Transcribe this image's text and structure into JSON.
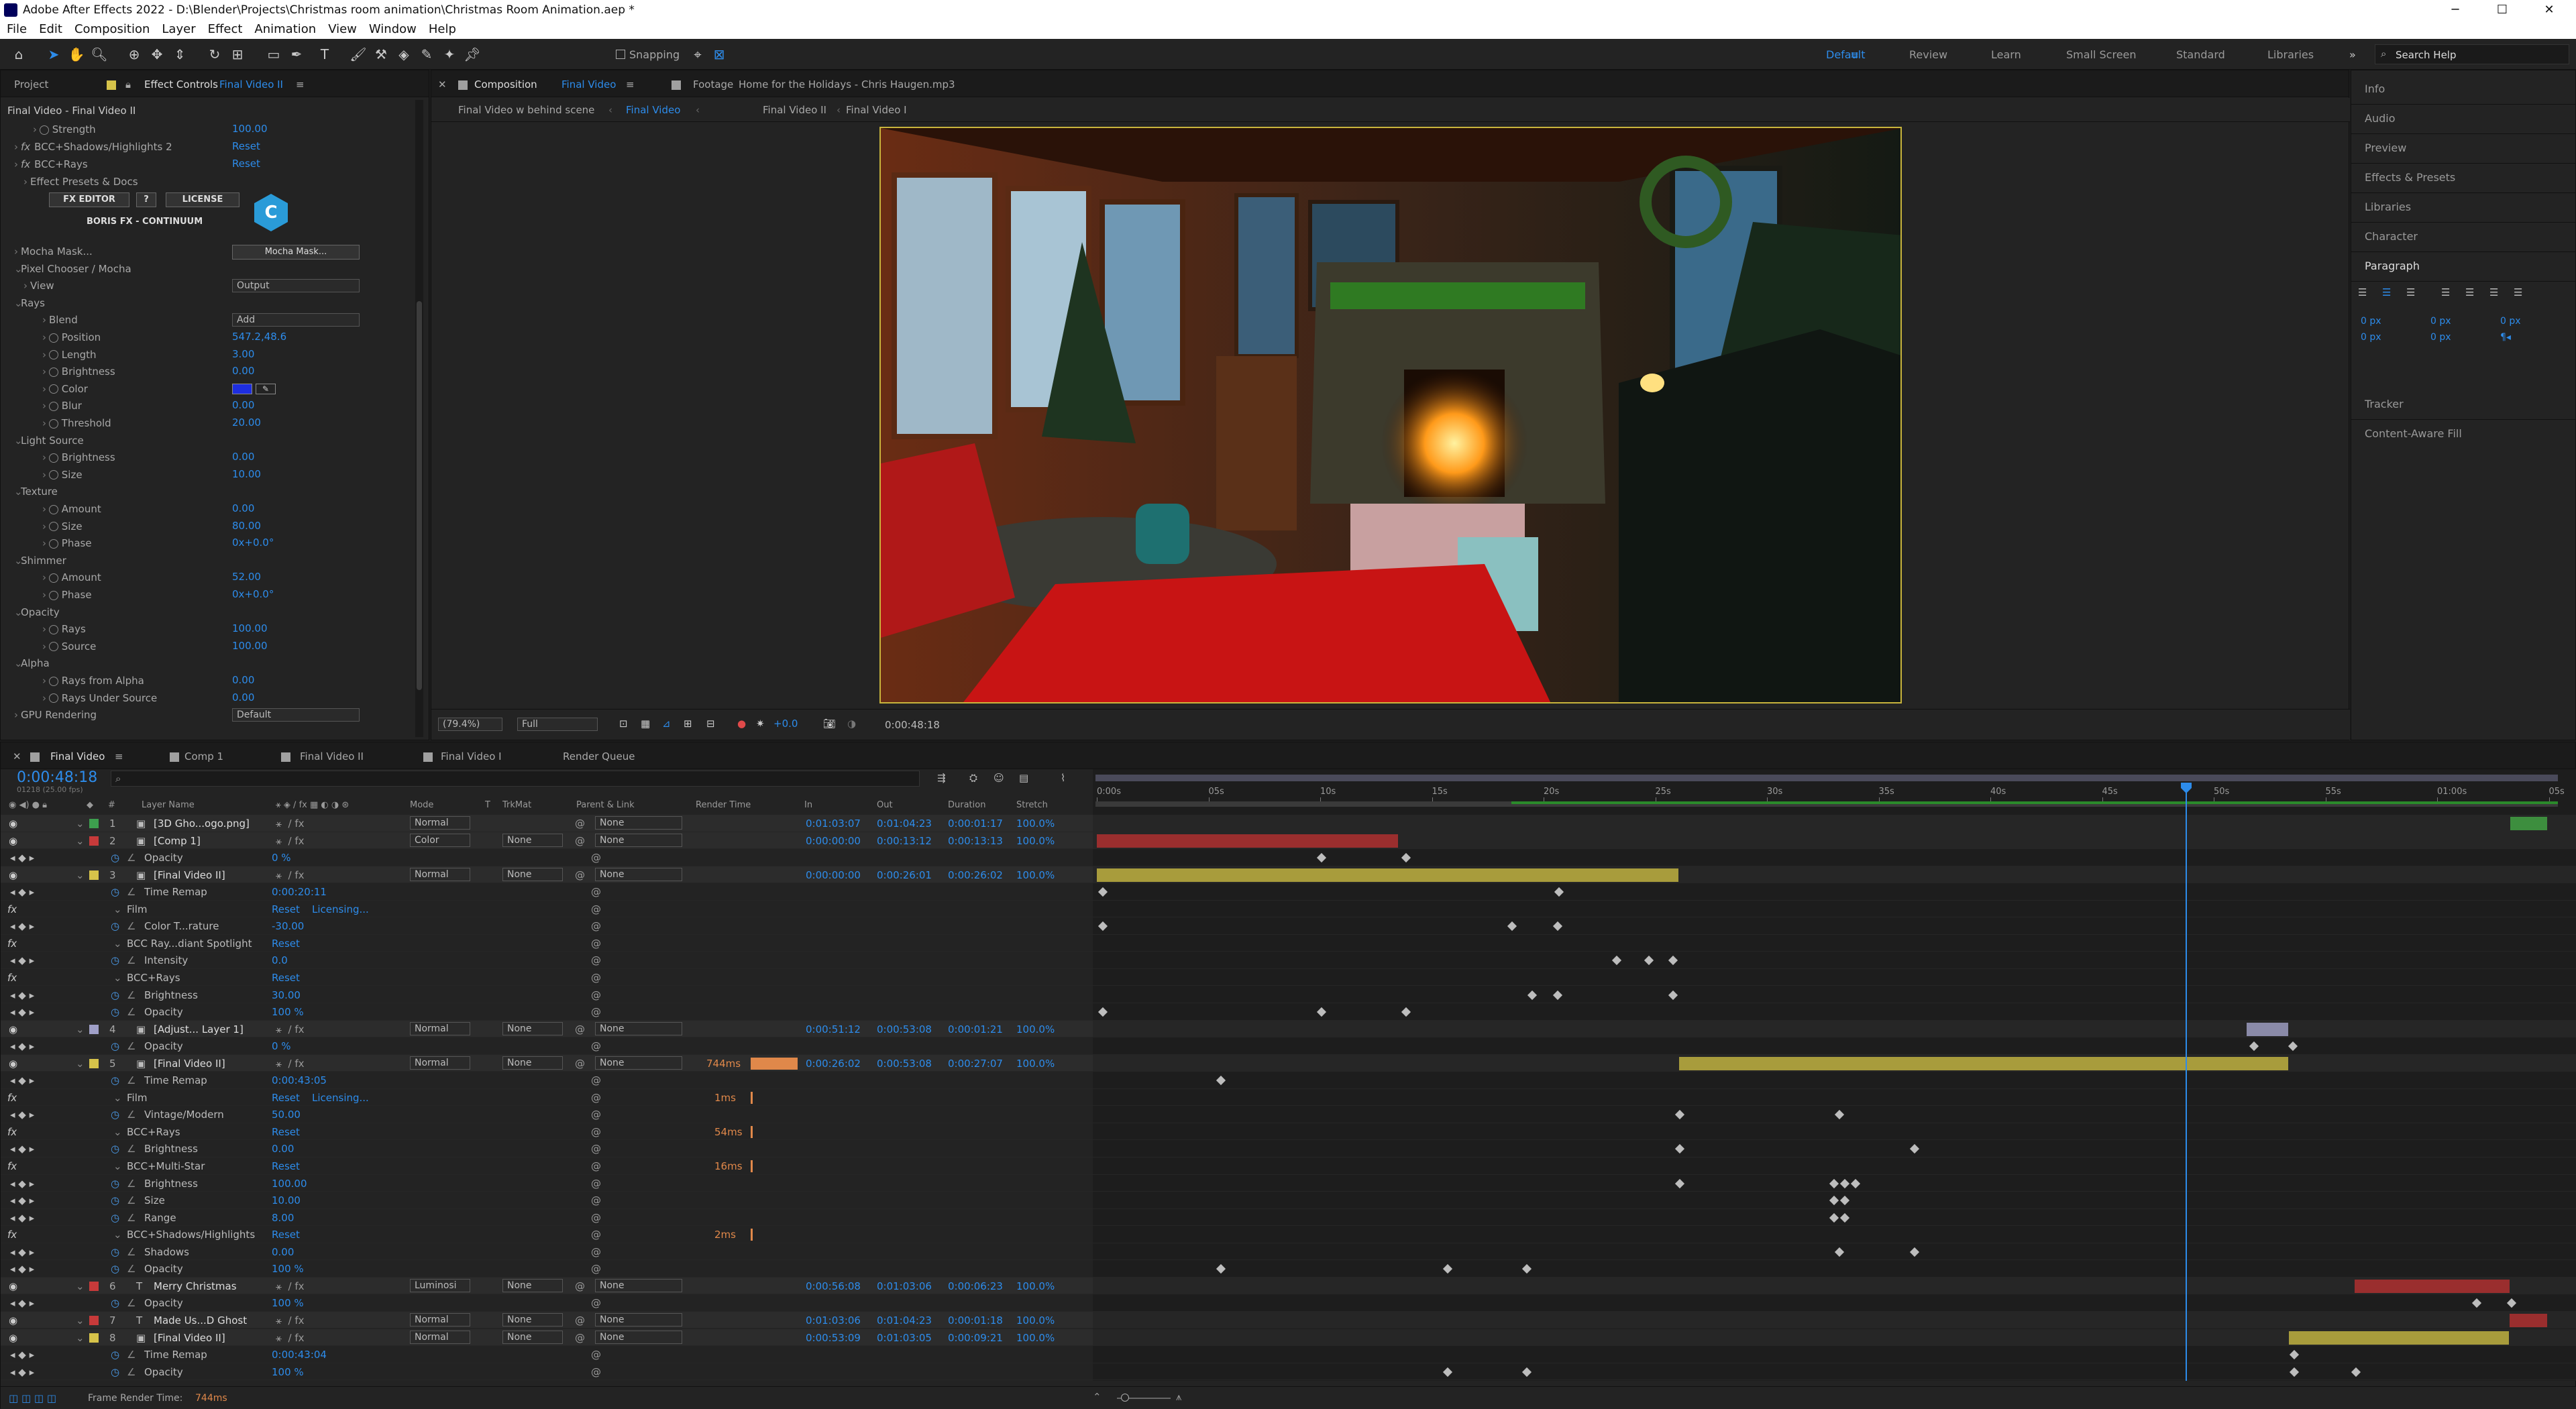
{
  "window": {
    "title": "Adobe After Effects 2022 - D:\\Blender\\Projects\\Christmas room animation\\Christmas Room Animation.aep *",
    "min": "─",
    "max": "☐",
    "close": "✕"
  },
  "menu": [
    "File",
    "Edit",
    "Composition",
    "Layer",
    "Effect",
    "Animation",
    "View",
    "Window",
    "Help"
  ],
  "toolbar": {
    "snapping": "Snapping",
    "workspaces": [
      "Default",
      "Review",
      "Learn",
      "Small Screen",
      "Standard",
      "Libraries"
    ],
    "search_placeholder": "Search Help"
  },
  "effect_controls": {
    "project_tab": "Project",
    "tab": "Effect Controls",
    "tab_layer": "Final Video II",
    "header": "Final Video - Final Video II",
    "rows": [
      {
        "label": "Strength",
        "value": "100.00",
        "indent": 3,
        "sw": true
      },
      {
        "label": "BCC+Shadows/Highlights 2",
        "value": "Reset",
        "indent": 1,
        "fx": true
      },
      {
        "label": "BCC+Rays",
        "value": "Reset",
        "indent": 1,
        "fx": true
      },
      {
        "label": "Effect Presets & Docs",
        "value": "",
        "indent": 2
      }
    ],
    "fx_editor": "FX EDITOR",
    "help_btn": "?",
    "license": "LICENSE",
    "brand": "BORIS FX - CONTINUUM",
    "brand_logo": "C",
    "rows2": [
      {
        "label": "Mocha Mask...",
        "btn": "Mocha Mask..."
      },
      {
        "label": "Pixel Chooser / Mocha"
      },
      {
        "label": "View",
        "dd": "Output"
      },
      {
        "label": "Rays"
      },
      {
        "label": "Blend",
        "dd": "Add"
      },
      {
        "label": "Position",
        "value": "547.2,48.6"
      },
      {
        "label": "Length",
        "value": "3.00"
      },
      {
        "label": "Brightness",
        "value": "0.00"
      },
      {
        "label": "Color",
        "value": ""
      },
      {
        "label": "Blur",
        "value": "0.00"
      },
      {
        "label": "Threshold",
        "value": "20.00"
      },
      {
        "label": "Light Source"
      },
      {
        "label": "Brightness",
        "value": "0.00"
      },
      {
        "label": "Size",
        "value": "10.00"
      },
      {
        "label": "Texture"
      },
      {
        "label": "Amount",
        "value": "0.00"
      },
      {
        "label": "Size",
        "value": "80.00"
      },
      {
        "label": "Phase",
        "value": "0x+0.0°"
      },
      {
        "label": "Shimmer"
      },
      {
        "label": "Amount",
        "value": "52.00"
      },
      {
        "label": "Phase",
        "value": "0x+0.0°"
      },
      {
        "label": "Opacity"
      },
      {
        "label": "Rays",
        "value": "100.00"
      },
      {
        "label": "Source",
        "value": "100.00"
      },
      {
        "label": "Alpha"
      },
      {
        "label": "Rays from Alpha",
        "value": "0.00"
      },
      {
        "label": "Rays Under Source",
        "value": "0.00"
      },
      {
        "label": "GPU Rendering",
        "dd": "Default"
      }
    ]
  },
  "composition": {
    "tab": "Composition",
    "tab_name": "Final Video",
    "footage_tab": "Footage",
    "footage_name": "Home for the Holidays - Chris Haugen.mp3",
    "breadcrumbs": [
      "Final Video w behind scene",
      "Final Video",
      "Final Video II",
      "Final Video I"
    ],
    "zoom": "(79.4%)",
    "quality": "Full",
    "exposure": "+0.0",
    "timecode": "0:00:48:18"
  },
  "right_panel": {
    "items": [
      "Info",
      "Audio",
      "Preview",
      "Effects & Presets",
      "Libraries",
      "Character",
      "Paragraph",
      "Tracker",
      "Content-Aware Fill"
    ],
    "para_values": [
      "0 px",
      "0 px",
      "0 px",
      "0 px",
      "0 px",
      "0 px"
    ]
  },
  "timeline": {
    "tabs": [
      "Final Video",
      "Comp 1",
      "Final Video II",
      "Final Video I",
      "Render Queue"
    ],
    "timecode": "0:00:48:18",
    "fps": "01218 (25.00 fps)",
    "columns": [
      "Layer Name",
      "Mode",
      "T",
      "TrkMat",
      "Parent & Link",
      "Render Time",
      "In",
      "Out",
      "Duration",
      "Stretch"
    ],
    "ruler": [
      "0:00s",
      "05s",
      "10s",
      "15s",
      "20s",
      "25s",
      "30s",
      "35s",
      "40s",
      "45s",
      "50s",
      "55s",
      "01:00s",
      "05s"
    ],
    "rows": [
      {
        "t": "layer",
        "n": "1",
        "name": "[3D Gho...ogo.png]",
        "mode": "Normal",
        "trk": "",
        "parent": "None",
        "rt": "",
        "in": "0:01:03:07",
        "out": "0:01:04:23",
        "dur": "0:00:01:17",
        "st": "100.0%",
        "color": "#3d9e4e"
      },
      {
        "t": "layer",
        "n": "2",
        "name": "[Comp 1]",
        "mode": "Color",
        "trk": "None",
        "parent": "None",
        "rt": "",
        "in": "0:00:00:00",
        "out": "0:00:13:12",
        "dur": "0:00:13:13",
        "st": "100.0%",
        "color": "#c73a3a"
      },
      {
        "t": "prop",
        "name": "Opacity",
        "val": "0 %"
      },
      {
        "t": "layer",
        "n": "3",
        "name": "[Final Video II]",
        "mode": "Normal",
        "trk": "None",
        "parent": "None",
        "rt": "",
        "in": "0:00:00:00",
        "out": "0:00:26:01",
        "dur": "0:00:26:02",
        "st": "100.0%",
        "color": "#d6c34a"
      },
      {
        "t": "prop",
        "name": "Time Remap",
        "val": "0:00:20:11"
      },
      {
        "t": "fx",
        "name": "Film",
        "val": "Reset",
        "extra": "Licensing..."
      },
      {
        "t": "prop",
        "name": "Color T...rature",
        "val": "-30.00"
      },
      {
        "t": "fx",
        "name": "BCC Ray...diant Spotlight",
        "val": "Reset"
      },
      {
        "t": "prop",
        "name": "Intensity",
        "val": "0.0"
      },
      {
        "t": "fx",
        "name": "BCC+Rays",
        "val": "Reset"
      },
      {
        "t": "prop",
        "name": "Brightness",
        "val": "30.00"
      },
      {
        "t": "prop",
        "name": "Opacity",
        "val": "100 %"
      },
      {
        "t": "layer",
        "n": "4",
        "name": "[Adjust... Layer 1]",
        "mode": "Normal",
        "trk": "None",
        "parent": "None",
        "rt": "",
        "in": "0:00:51:12",
        "out": "0:00:53:08",
        "dur": "0:00:01:21",
        "st": "100.0%",
        "color": "#a0a0c8"
      },
      {
        "t": "prop",
        "name": "Opacity",
        "val": "0 %"
      },
      {
        "t": "layer",
        "n": "5",
        "name": "[Final Video II]",
        "mode": "Normal",
        "trk": "None",
        "parent": "None",
        "rt": "744ms",
        "in": "0:00:26:02",
        "out": "0:00:53:08",
        "dur": "0:00:27:07",
        "st": "100.0%",
        "color": "#d6c34a"
      },
      {
        "t": "prop",
        "name": "Time Remap",
        "val": "0:00:43:05"
      },
      {
        "t": "fx",
        "name": "Film",
        "val": "Reset",
        "extra": "Licensing...",
        "rt": "1ms"
      },
      {
        "t": "prop",
        "name": "Vintage/Modern",
        "val": "50.00"
      },
      {
        "t": "fx",
        "name": "BCC+Rays",
        "val": "Reset",
        "rt": "54ms"
      },
      {
        "t": "prop",
        "name": "Brightness",
        "val": "0.00"
      },
      {
        "t": "fx",
        "name": "BCC+Multi-Star",
        "val": "Reset",
        "rt": "16ms"
      },
      {
        "t": "prop",
        "name": "Brightness",
        "val": "100.00"
      },
      {
        "t": "prop",
        "name": "Size",
        "val": "10.00"
      },
      {
        "t": "prop",
        "name": "Range",
        "val": "8.00"
      },
      {
        "t": "fx",
        "name": "BCC+Shadows/Highlights",
        "val": "Reset",
        "rt": "2ms"
      },
      {
        "t": "prop",
        "name": "Shadows",
        "val": "0.00"
      },
      {
        "t": "prop",
        "name": "Opacity",
        "val": "100 %"
      },
      {
        "t": "layer",
        "n": "6",
        "name": "Merry Christmas",
        "mode": "Luminosi",
        "trk": "None",
        "parent": "None",
        "rt": "",
        "in": "0:00:56:08",
        "out": "0:01:03:06",
        "dur": "0:00:06:23",
        "st": "100.0%",
        "color": "#c73a3a",
        "text": true
      },
      {
        "t": "prop",
        "name": "Opacity",
        "val": "100 %"
      },
      {
        "t": "layer",
        "n": "7",
        "name": "Made Us...D Ghost",
        "mode": "Normal",
        "trk": "None",
        "parent": "None",
        "rt": "",
        "in": "0:01:03:06",
        "out": "0:01:04:23",
        "dur": "0:00:01:18",
        "st": "100.0%",
        "color": "#c73a3a",
        "text": true
      },
      {
        "t": "layer",
        "n": "8",
        "name": "[Final Video II]",
        "mode": "Normal",
        "trk": "None",
        "parent": "None",
        "rt": "",
        "in": "0:00:53:09",
        "out": "0:01:03:05",
        "dur": "0:00:09:21",
        "st": "100.0%",
        "color": "#d6c34a"
      },
      {
        "t": "prop",
        "name": "Time Remap",
        "val": "0:00:43:04"
      },
      {
        "t": "prop",
        "name": "Opacity",
        "val": "100 %"
      }
    ],
    "status": "Frame Render Time:",
    "status_val": "744ms"
  }
}
